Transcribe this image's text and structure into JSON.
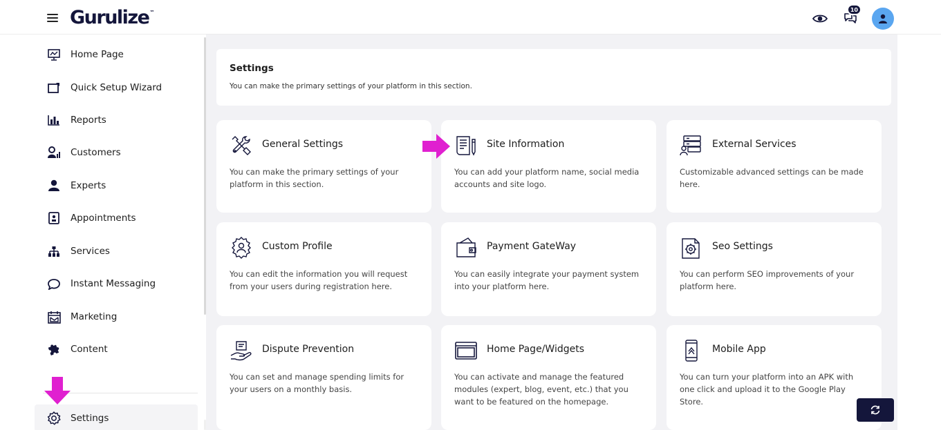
{
  "app": {
    "logo": "Gurulize",
    "logo_mark": "™"
  },
  "topbar": {
    "notification_count": "10"
  },
  "sidebar": {
    "items": [
      {
        "label": "Home Page",
        "icon": "monitor-icon"
      },
      {
        "label": "Quick Setup Wizard",
        "icon": "wizard-icon"
      },
      {
        "label": "Reports",
        "icon": "bar-chart-icon"
      },
      {
        "label": "Customers",
        "icon": "customers-icon"
      },
      {
        "label": "Experts",
        "icon": "user-icon"
      },
      {
        "label": "Appointments",
        "icon": "badge-icon"
      },
      {
        "label": "Services",
        "icon": "sitemap-icon"
      },
      {
        "label": "Instant Messaging",
        "icon": "chat-icon"
      },
      {
        "label": "Marketing",
        "icon": "calendar-mail-icon"
      },
      {
        "label": "Content",
        "icon": "puzzle-icon"
      },
      {
        "label": "Settings",
        "icon": "gear-icon"
      }
    ]
  },
  "main": {
    "header": {
      "title": "Settings",
      "subtitle": "You can make the primary settings of your platform in this section."
    },
    "cards": [
      {
        "title": "General Settings",
        "desc": "You can make the primary settings of your platform in this section.",
        "icon": "tools-icon"
      },
      {
        "title": "Site Information",
        "desc": "You can add your platform name, social media accounts and site logo.",
        "icon": "document-pen-icon"
      },
      {
        "title": "External Services",
        "desc": "Customizable advanced settings can be made here.",
        "icon": "server-user-icon"
      },
      {
        "title": "Custom Profile",
        "desc": "You can edit the information you will request from your users during registration here.",
        "icon": "profile-gear-icon"
      },
      {
        "title": "Payment GateWay",
        "desc": "You can easily integrate your payment system into your platform here.",
        "icon": "wallet-icon"
      },
      {
        "title": "Seo Settings",
        "desc": "You can perform SEO improvements of your platform here.",
        "icon": "seo-gear-icon"
      },
      {
        "title": "Dispute Prevention",
        "desc": "You can set and manage spending limits for your users on a monthly basis.",
        "icon": "hand-shield-icon"
      },
      {
        "title": "Home Page/Widgets",
        "desc": "You can activate and manage the featured modules (expert, blog, event, etc.) that you want to be featured on the homepage.",
        "icon": "browser-window-icon"
      },
      {
        "title": "Mobile App",
        "desc": "You can turn your platform into an APK with one click and upload it to the Google Play Store.",
        "icon": "mobile-icon"
      }
    ]
  },
  "colors": {
    "brand_navy": "#14163b",
    "arrow_magenta": "#e020d0",
    "avatar_blue": "#5aa6f0",
    "main_bg": "#f2f2f5"
  }
}
